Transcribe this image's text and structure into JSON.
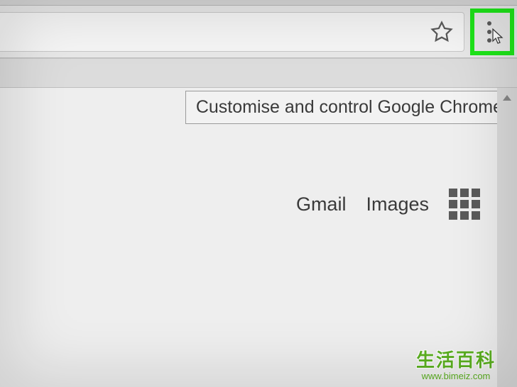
{
  "browser": {
    "tooltip_text": "Customise and control Google Chrome"
  },
  "nav": {
    "gmail": "Gmail",
    "images": "Images"
  },
  "watermark": {
    "main": "生活百科",
    "url": "www.bimeiz.com"
  },
  "highlight_color": "#1ee619"
}
